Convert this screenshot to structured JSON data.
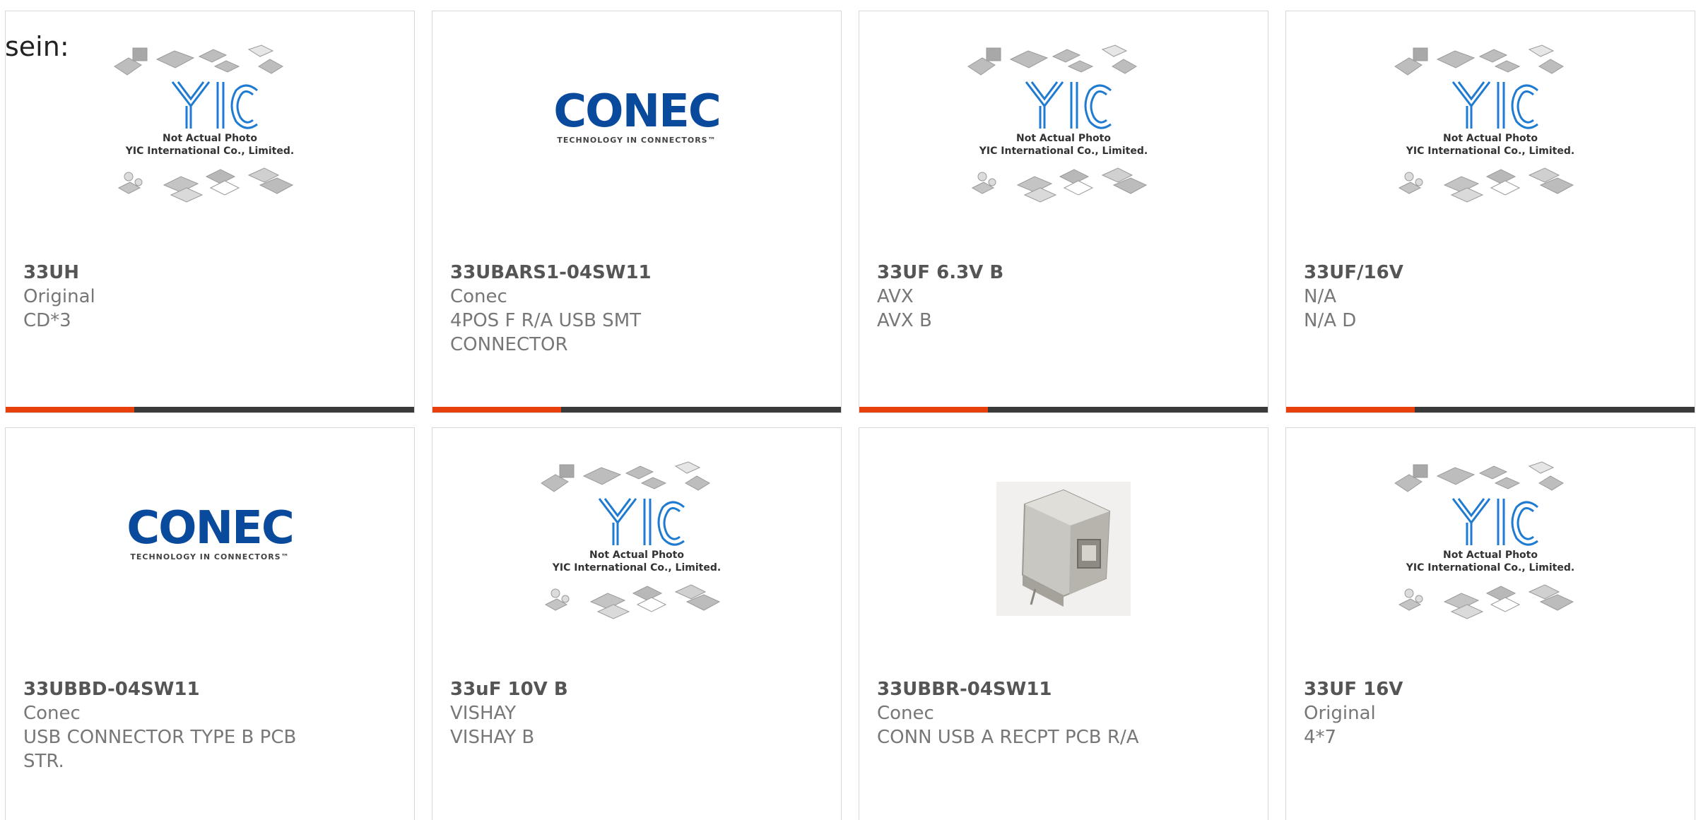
{
  "lead_text": "sein:",
  "placeholder_image": {
    "line1": "Not Actual Photo",
    "line2": "YIC International Co., Limited.",
    "logo": "YIC"
  },
  "conec_logo": {
    "brand": "CONEC",
    "tagline": "TECHNOLOGY IN CONNECTORS™"
  },
  "colors": {
    "accent": "#e8400c",
    "bar": "#3a3a3a",
    "yic_blue": "#1f7bd1",
    "conec_blue": "#0a4a9c"
  },
  "products": [
    {
      "part": "33UH",
      "maker": "Original",
      "desc": "CD*3",
      "image": "yic-placeholder"
    },
    {
      "part": "33UBARS1-04SW11",
      "maker": "Conec",
      "desc": "4POS F R/A USB SMT CONNECTOR",
      "image": "conec-logo"
    },
    {
      "part": "33UF 6.3V B",
      "maker": "AVX",
      "desc": "AVX B",
      "image": "yic-placeholder"
    },
    {
      "part": "33UF/16V",
      "maker": "N/A",
      "desc": "N/A D",
      "image": "yic-placeholder"
    },
    {
      "part": "33UBBD-04SW11",
      "maker": "Conec",
      "desc": "USB CONNECTOR TYPE B PCB STR.",
      "image": "conec-logo"
    },
    {
      "part": "33uF 10V B",
      "maker": "VISHAY",
      "desc": "VISHAY B",
      "image": "yic-placeholder"
    },
    {
      "part": "33UBBR-04SW11",
      "maker": "Conec",
      "desc": "CONN USB A RECPT PCB R/A",
      "image": "usb-connector-photo"
    },
    {
      "part": "33UF 16V",
      "maker": "Original",
      "desc": "4*7",
      "image": "yic-placeholder"
    }
  ]
}
